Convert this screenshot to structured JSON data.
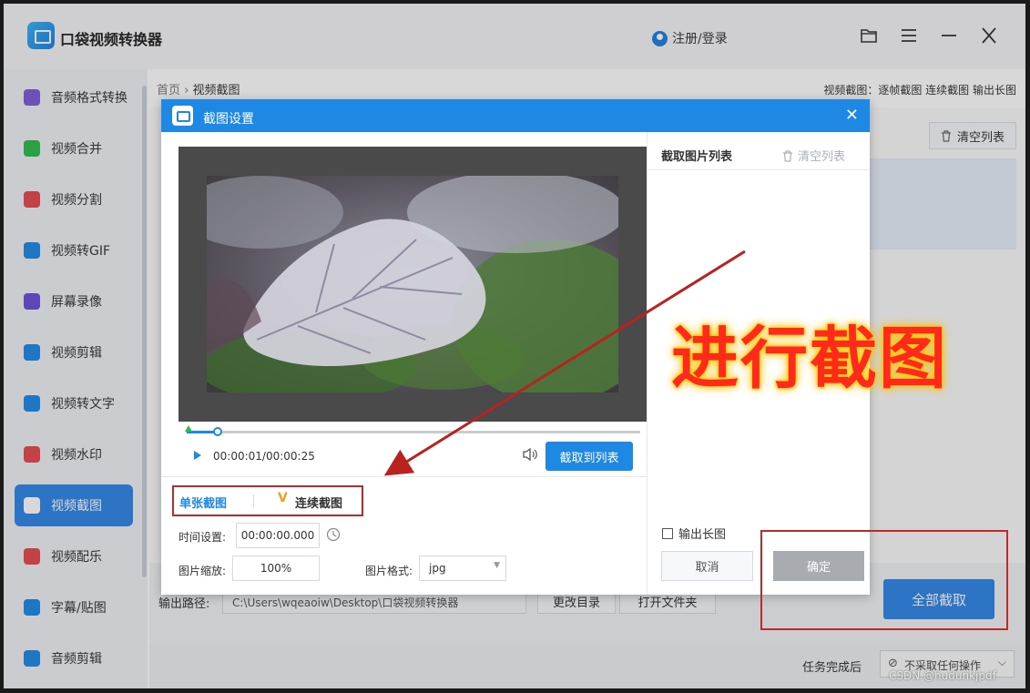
{
  "app": {
    "title": "口袋视频转换器",
    "login_label": "注册/登录"
  },
  "sidebar": {
    "items": [
      {
        "label": "音频格式转换",
        "color": "#7b5cd6"
      },
      {
        "label": "视频合并",
        "color": "#2bbd4a"
      },
      {
        "label": "视频分割",
        "color": "#e5484d"
      },
      {
        "label": "视频转GIF",
        "color": "#1e88e5"
      },
      {
        "label": "屏幕录像",
        "color": "#6a4fd8"
      },
      {
        "label": "视频剪辑",
        "color": "#1e88e5"
      },
      {
        "label": "视频转文字",
        "color": "#1e88e5"
      },
      {
        "label": "视频水印",
        "color": "#e5484d"
      },
      {
        "label": "视频截图",
        "color": "#ffffff",
        "active": true
      },
      {
        "label": "视频配乐",
        "color": "#e5484d"
      },
      {
        "label": "字幕/贴图",
        "color": "#1e88e5"
      },
      {
        "label": "音频剪辑",
        "color": "#1e88e5"
      }
    ]
  },
  "breadcrumb": {
    "home": "首页",
    "sep": "›",
    "current": "视频截图"
  },
  "header_hint": "视频截图：逐帧截图 连续截图 输出长图",
  "main": {
    "clear_list": "清空列表"
  },
  "output": {
    "label": "输出路径:",
    "path": "C:\\Users\\wqeaoiw\\Desktop\\口袋视频转换器",
    "change_dir": "更改目录",
    "open_folder": "打开文件夹",
    "capture_all": "全部截取"
  },
  "task": {
    "label": "任务完成后",
    "selected": "不采取任何操作"
  },
  "watermark": "CSDN @hudunkjpdf",
  "dialog": {
    "title": "截图设置",
    "time_display": "00:00:01/00:00:25",
    "capture_to_list": "截取到列表",
    "mode_single": "单张截图",
    "mode_continuous": "连续截图",
    "time_setting_label": "时间设置:",
    "time_setting_value": "00:00:00.000",
    "scale_label": "图片缩放:",
    "scale_value": "100%",
    "format_label": "图片格式:",
    "format_value": "jpg",
    "list_title": "截取图片列表",
    "list_clear": "清空列表",
    "long_image_label": "输出长图",
    "cancel": "取消",
    "confirm": "确定"
  },
  "annotation": {
    "text": "进行截图",
    "color": "#ff2a1a"
  },
  "colors": {
    "accent": "#1e88e5",
    "annotation_red": "#c0282b"
  }
}
